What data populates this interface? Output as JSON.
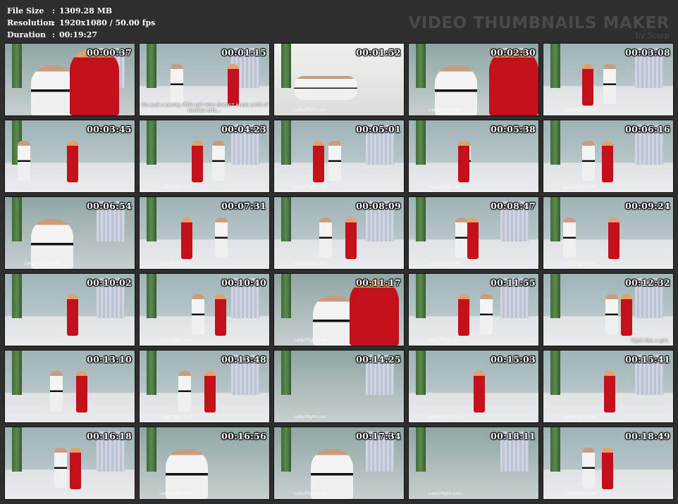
{
  "info": {
    "file_size_label": "File Size",
    "file_size_value": "1309.28 MB",
    "resolution_label": "Resolution",
    "resolution_value": "1920x1080 / 50.00 fps",
    "duration_label": "Duration",
    "duration_value": "00:19:27",
    "separator": ":"
  },
  "brand": {
    "title": "VIDEO THUMBNAILS MAKER",
    "subtitle": "by Scorp"
  },
  "watermark": "Lady2fight.com",
  "thumbnails": [
    {
      "time": "00:00:37"
    },
    {
      "time": "00:01:15",
      "caption": "You just a pretty little girl who doesn't know a bit of martial arts..."
    },
    {
      "time": "00:01:52"
    },
    {
      "time": "00:02:30"
    },
    {
      "time": "00:03:08"
    },
    {
      "time": "00:03:45"
    },
    {
      "time": "00:04:23"
    },
    {
      "time": "00:05:01"
    },
    {
      "time": "00:05:38"
    },
    {
      "time": "00:06:16"
    },
    {
      "time": "00:06:54"
    },
    {
      "time": "00:07:31"
    },
    {
      "time": "00:08:09"
    },
    {
      "time": "00:08:47"
    },
    {
      "time": "00:09:24"
    },
    {
      "time": "00:10:02"
    },
    {
      "time": "00:10:40"
    },
    {
      "time": "00:11:17"
    },
    {
      "time": "00:11:55"
    },
    {
      "time": "00:12:32",
      "caption_right": "Fight like a girl."
    },
    {
      "time": "00:13:10"
    },
    {
      "time": "00:13:48"
    },
    {
      "time": "00:14:25"
    },
    {
      "time": "00:15:03"
    },
    {
      "time": "00:15:41"
    },
    {
      "time": "00:16:18"
    },
    {
      "time": "00:16:56"
    },
    {
      "time": "00:17:34"
    },
    {
      "time": "00:18:11"
    },
    {
      "time": "00:18:49"
    }
  ]
}
